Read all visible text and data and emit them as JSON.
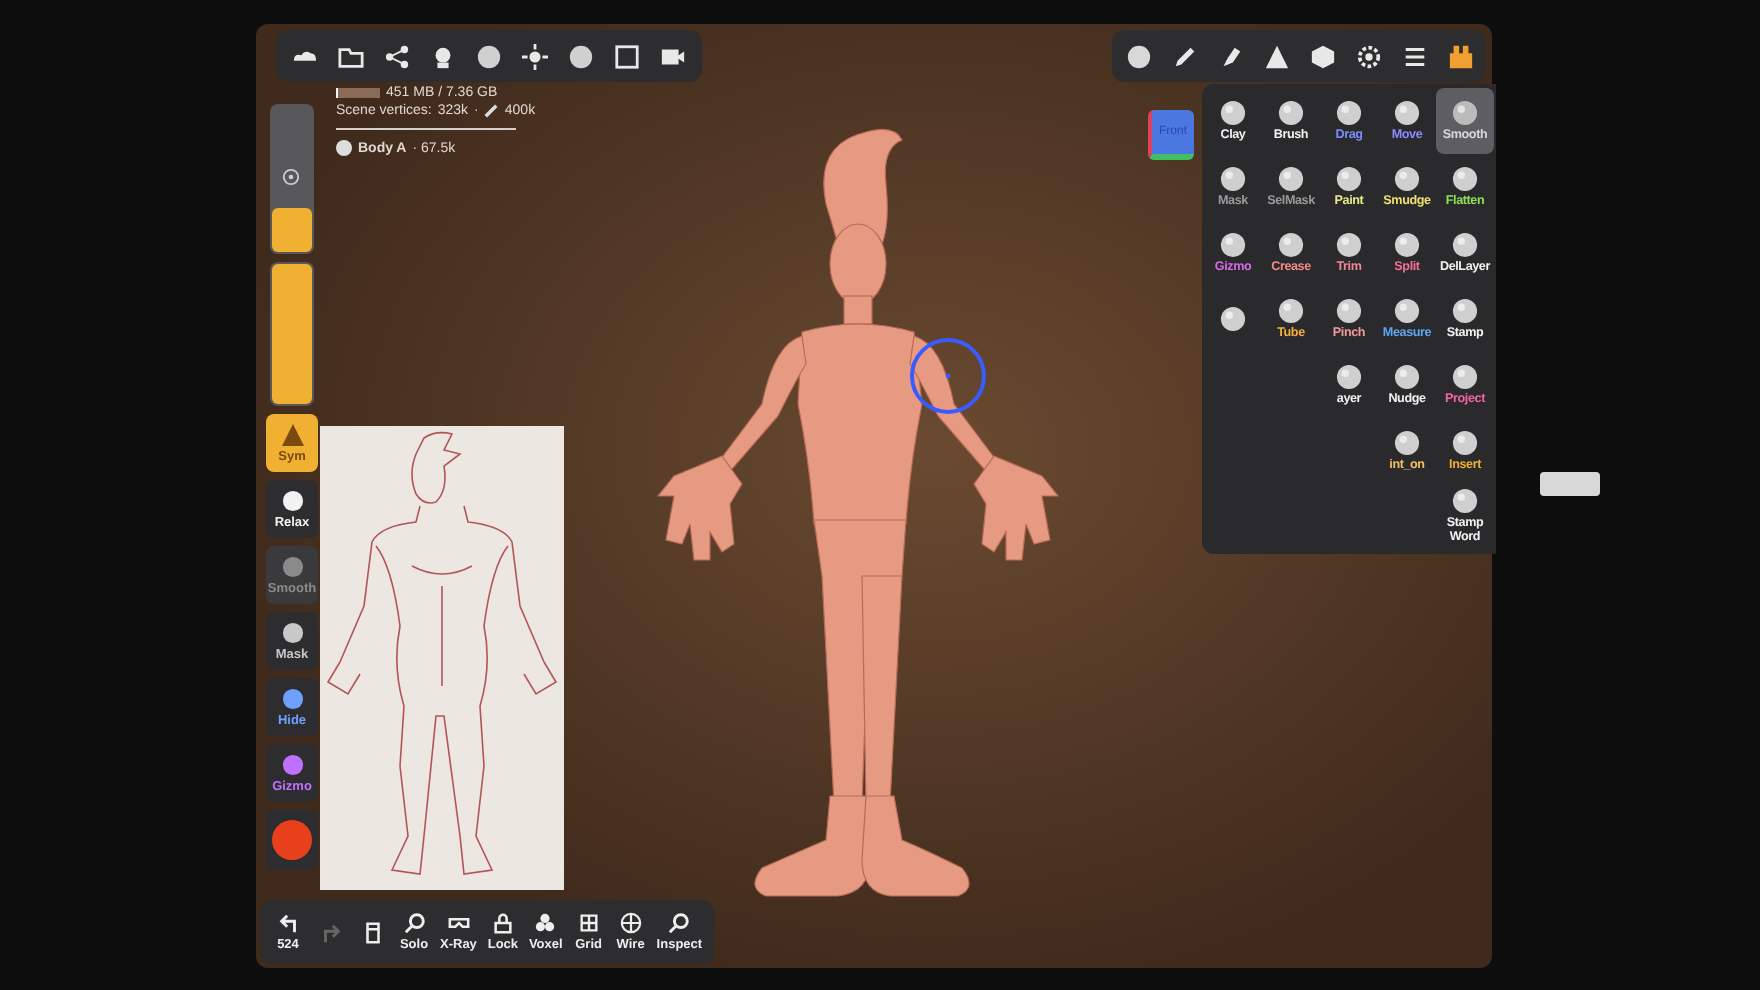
{
  "info": {
    "memory": "451 MB / 7.36 GB",
    "memory_bar": {
      "level": 0.06
    },
    "vertices_label": "Scene vertices:",
    "vertices": "323k",
    "vertices_sep": "·",
    "vertex_limit": "400k",
    "object": "Body A",
    "object_count": "· 67.5k"
  },
  "view_cube": {
    "label": "Front"
  },
  "tools": [
    {
      "kind": "tool",
      "label": "Clay",
      "color": "#f2f2f2",
      "selected": false
    },
    {
      "kind": "tool",
      "label": "Brush",
      "color": "#f2f2f2",
      "selected": false
    },
    {
      "kind": "tool",
      "label": "Drag",
      "color": "#7f8cff",
      "selected": false
    },
    {
      "kind": "tool",
      "label": "Move",
      "color": "#8a8cff",
      "selected": false
    },
    {
      "kind": "tool",
      "label": "Smooth",
      "color": "#d8d8d8",
      "selected": true
    },
    {
      "kind": "tool",
      "label": "Mask",
      "color": "#9a9a9a",
      "selected": false
    },
    {
      "kind": "tool",
      "label": "SelMask",
      "color": "#9a9a9a",
      "selected": false
    },
    {
      "kind": "tool",
      "label": "Paint",
      "color": "#e6ec8c",
      "selected": false
    },
    {
      "kind": "tool",
      "label": "Smudge",
      "color": "#ece070",
      "selected": false
    },
    {
      "kind": "tool",
      "label": "Flatten",
      "color": "#8fe05a",
      "selected": false
    },
    {
      "kind": "tool",
      "label": "Gizmo",
      "color": "#d46ae6",
      "selected": false
    },
    {
      "kind": "tool",
      "label": "Crease",
      "color": "#f28a8a",
      "selected": false
    },
    {
      "kind": "tool",
      "label": "Trim",
      "color": "#f0869a",
      "selected": false
    },
    {
      "kind": "tool",
      "label": "Split",
      "color": "#f0709a",
      "selected": false
    },
    {
      "kind": "tool",
      "label": "DelLayer",
      "color": "#f2f2f2",
      "selected": false
    },
    {
      "kind": "tool",
      "selected": false
    },
    {
      "kind": "tool",
      "label": "Tube",
      "color": "#f0b040",
      "selected": false
    },
    {
      "kind": "tool",
      "label": "Pinch",
      "color": "#f09a9a",
      "selected": false
    },
    {
      "kind": "tool",
      "label": "Measure",
      "color": "#5fa6f2",
      "selected": false
    },
    {
      "kind": "tool",
      "label": "Stamp",
      "color": "#f2f2f2",
      "selected": false
    },
    {
      "kind": "covered"
    },
    {
      "kind": "covered"
    },
    {
      "kind": "tool",
      "label": "ayer",
      "color": "#f2f2f2",
      "selected": false
    },
    {
      "kind": "tool",
      "label": "Nudge",
      "color": "#f2f2f2",
      "selected": false
    },
    {
      "kind": "tool",
      "label": "Project",
      "color": "#f066a8",
      "selected": false
    },
    {
      "kind": "covered"
    },
    {
      "kind": "covered"
    },
    {
      "kind": "covered"
    },
    {
      "kind": "tool",
      "label": "int_on",
      "color": "#f2c060",
      "selected": false
    },
    {
      "kind": "tool",
      "label": "Insert",
      "color": "#f0b030",
      "selected": false
    },
    {
      "kind": "covered"
    },
    {
      "kind": "covered"
    },
    {
      "kind": "covered"
    },
    {
      "kind": "covered"
    },
    {
      "kind": "tool",
      "label": "Stamp Word",
      "color": "#f2f2f2",
      "selected": false
    }
  ],
  "sidebar": [
    {
      "kind": "slider",
      "level": 0.3
    },
    {
      "kind": "slider",
      "level": 1
    },
    {
      "kind": "button",
      "label": "Sym",
      "selected": true,
      "disabled": false,
      "color": "#7a4a10"
    },
    {
      "kind": "button",
      "label": "Relax",
      "selected": false,
      "disabled": false,
      "color": "#f2f2f2"
    },
    {
      "kind": "button",
      "label": "Smooth",
      "selected": false,
      "disabled": true,
      "color": "#8a8a8a"
    },
    {
      "kind": "button",
      "label": "Mask",
      "selected": false,
      "disabled": false,
      "color": "#c8c8c8"
    },
    {
      "kind": "button",
      "label": "Hide",
      "selected": false,
      "disabled": false,
      "color": "#6fa0ff"
    },
    {
      "kind": "button",
      "label": "Gizmo",
      "selected": false,
      "disabled": false,
      "color": "#c070ff"
    },
    {
      "kind": "swatch",
      "color": "#e8401c"
    }
  ],
  "bottom_toolbar": [
    {
      "kind": "undo",
      "label": "524",
      "disabled": false
    },
    {
      "kind": "redo",
      "disabled": true
    },
    {
      "kind": "layers",
      "disabled": false
    },
    {
      "kind": "search",
      "label": "Solo",
      "disabled": false
    },
    {
      "kind": "glasses",
      "label": "X-Ray",
      "disabled": false
    },
    {
      "kind": "lock",
      "label": "Lock",
      "disabled": false
    },
    {
      "kind": "voxel",
      "label": "Voxel",
      "disabled": false
    },
    {
      "kind": "grid",
      "label": "Grid",
      "disabled": false
    },
    {
      "kind": "wire",
      "label": "Wire",
      "disabled": false
    },
    {
      "kind": "inspect",
      "label": "Inspect",
      "disabled": false
    }
  ]
}
